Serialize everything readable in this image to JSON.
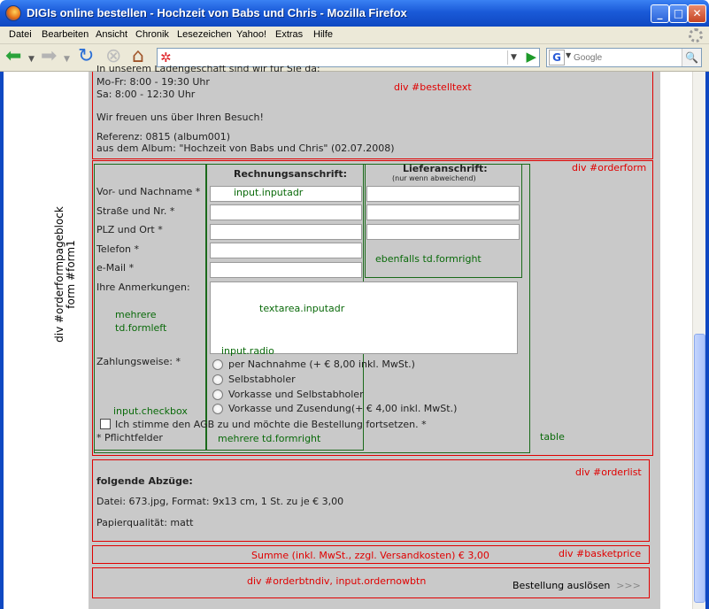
{
  "window": {
    "title": "DIGIs online bestellen - Hochzeit von Babs und Chris - Mozilla Firefox",
    "minimize": "_",
    "maximize": "□",
    "close": "✕"
  },
  "menu": [
    "Datei",
    "Bearbeiten",
    "Ansicht",
    "Chronik",
    "Lesezeichen",
    "Yahoo!",
    "Extras",
    "Hilfe"
  ],
  "toolbar": {
    "url": "",
    "search_placeholder": "Google",
    "search_engine_icon": "G"
  },
  "annotations": {
    "side_line1": "div #orderformpageblock",
    "side_line2": "form #form1",
    "bestelltext": "div #bestelltext",
    "orderform": "div #orderform",
    "inputadr": "input.inputadr",
    "ebenfalls": "ebenfalls td.formright",
    "textarea": "textarea.inputadr",
    "formleft_1": "mehrere",
    "formleft_2": "td.formleft",
    "radio": "input.radio",
    "checkbox": "input.checkbox",
    "formright": "mehrere td.formright",
    "table": "table",
    "orderlist": "div #orderlist",
    "basketprice": "div #basketprice",
    "orderbtn": "div #orderbtndiv, input.ordernowbtn"
  },
  "bestelltext": {
    "partial": "In unserem Ladengeschäft sind wir für Sie da:",
    "hours1": "Mo-Fr: 8:00 - 19:30 Uhr",
    "hours2": "Sa: 8:00 - 12:30 Uhr",
    "welcome": "Wir freuen uns über Ihren Besuch!",
    "ref": "Referenz: 0815 (album001)",
    "album": "aus dem Album: \"Hochzeit von Babs und Chris\" (02.07.2008)"
  },
  "form": {
    "billing_header": "Rechnungsanschrift:",
    "shipping_header": "Lieferanschrift:",
    "shipping_sub": "(nur wenn abweichend)",
    "labels": [
      "Vor- und Nachname *",
      "Straße und Nr. *",
      "PLZ und Ort *",
      "Telefon *",
      "e-Mail *"
    ],
    "remarks_label": "Ihre Anmerkungen:",
    "payment_label": "Zahlungsweise: *",
    "payment_options": [
      "per Nachnahme (+ € 8,00 inkl. MwSt.)",
      "Selbstabholer",
      "Vorkasse und Selbstabholer",
      "Vorkasse und Zusendung(+ € 4,00 inkl. MwSt.)"
    ],
    "agb": "Ich stimme den AGB zu und möchte die Bestellung fortsetzen. *",
    "required_note": "* Pflichtfelder"
  },
  "orderlist": {
    "title": "folgende Abzüge:",
    "file": "Datei: 673.jpg, Format: 9x13 cm, 1 St. zu je € 3,00",
    "quality": "Papierqualität: matt"
  },
  "basket": {
    "sum": "Summe (inkl. MwSt., zzgl. Versandkosten) € 3,00"
  },
  "order_button": {
    "label": "Bestellung auslösen",
    "arrows": ">>>"
  }
}
